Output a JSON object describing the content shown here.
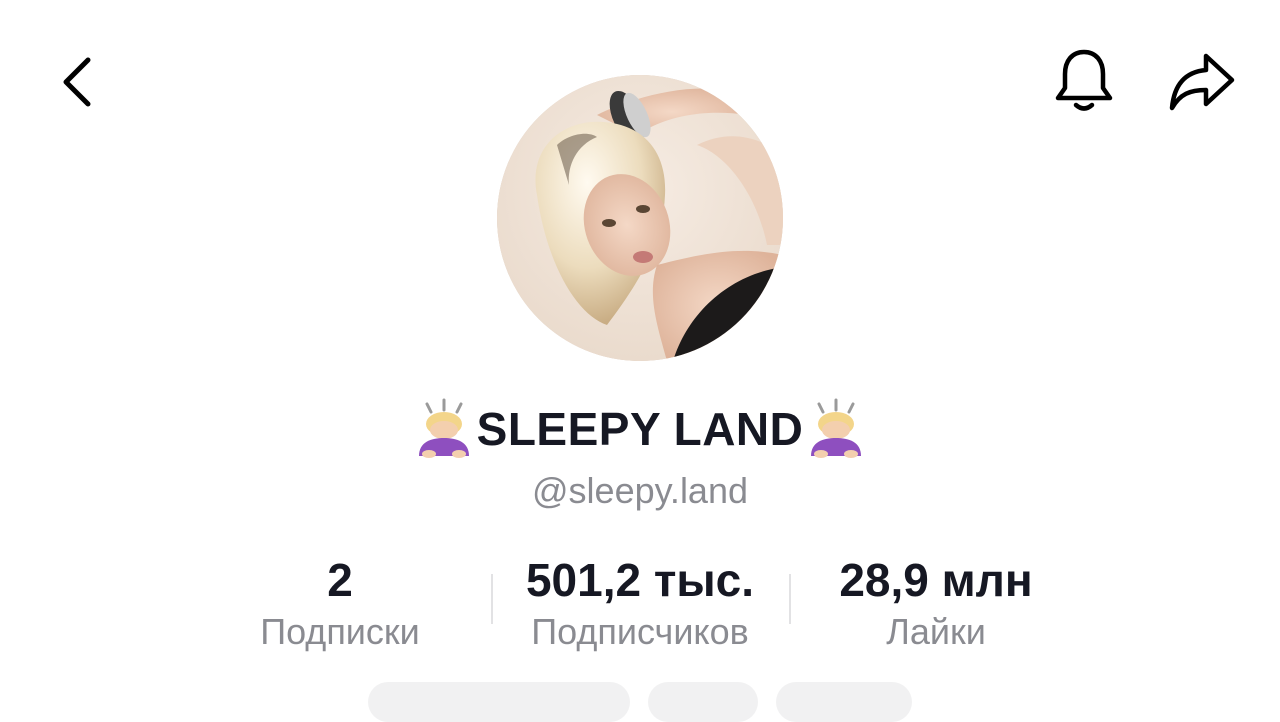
{
  "header": {
    "back_icon": "chevron-left-icon",
    "notification_icon": "bell-icon",
    "share_icon": "share-arrow-icon"
  },
  "profile": {
    "display_name": "SLEEPY LAND",
    "name_emoji": "🙇🏼‍♀️",
    "username": "@sleepy.land"
  },
  "stats": [
    {
      "value": "2",
      "label": "Подписки"
    },
    {
      "value": "501,2 тыс.",
      "label": "Подписчиков"
    },
    {
      "value": "28,9 млн",
      "label": "Лайки"
    }
  ],
  "colors": {
    "text_primary": "#161823",
    "text_secondary": "#8a8b91",
    "divider": "#e2e2e4"
  }
}
